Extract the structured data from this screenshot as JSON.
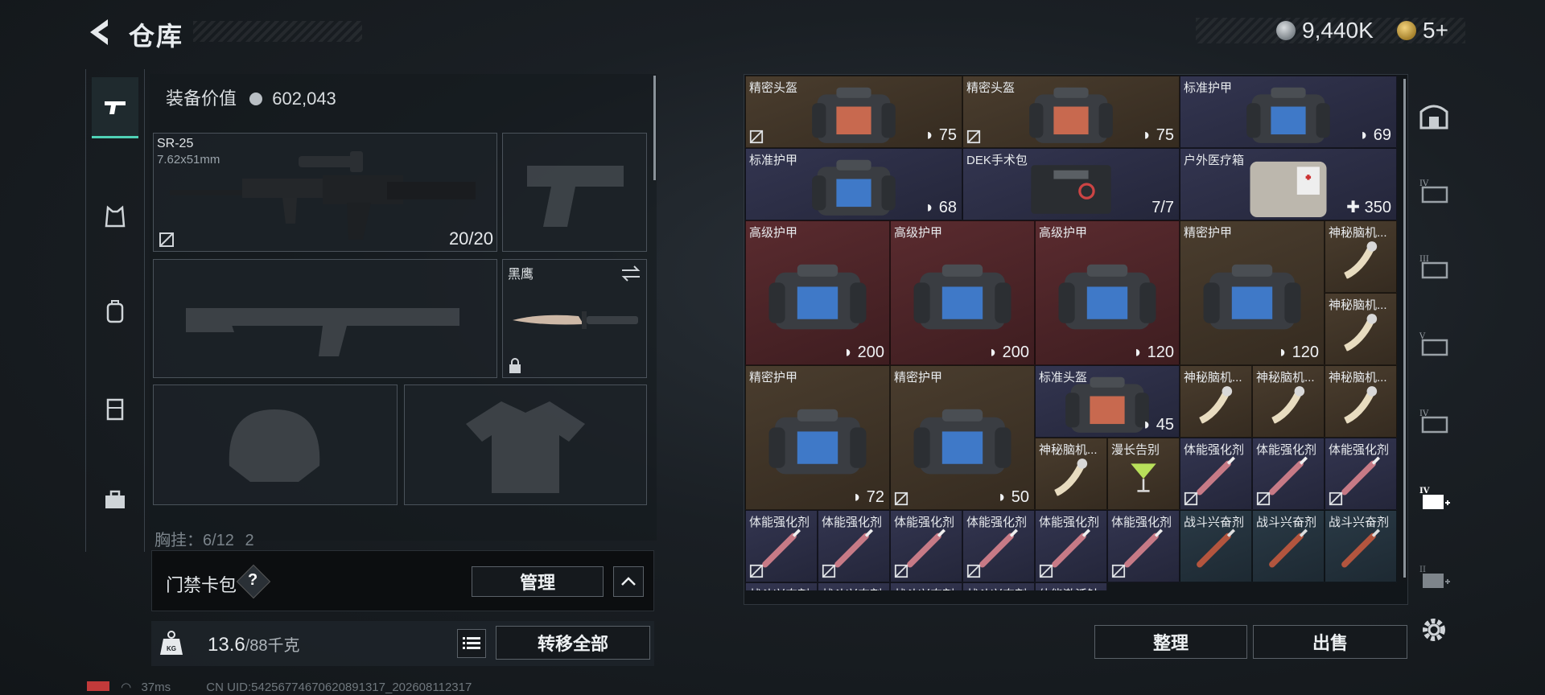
{
  "header": {
    "title": "仓库"
  },
  "currency": {
    "coins": "9,440K",
    "tickets": "5+",
    "colors": {
      "coin": "#b9bfc4",
      "ticket": "#d4aa45"
    }
  },
  "left_rail": {
    "items": [
      "pistol-icon",
      "vest-icon",
      "backpack-icon",
      "rig-icon",
      "toolbox-icon"
    ]
  },
  "equipment": {
    "value_label": "装备价值",
    "value": "602,043",
    "primary": {
      "name": "SR-25",
      "caliber": "7.62x51mm",
      "ammo": "20/20"
    },
    "melee": {
      "name": "黑鹰"
    },
    "chest_label": "胸挂：6/12",
    "chest_extra": "2"
  },
  "access_card": {
    "label": "门禁卡包",
    "help": "?",
    "manage": "管理"
  },
  "weight": {
    "value": "13.6",
    "max": "/88千克",
    "transfer_all": "转移全部"
  },
  "inventory": {
    "cells": [
      {
        "name": "精密头盔",
        "value": "75",
        "shield": true,
        "noicon": true,
        "bg": "brown",
        "item": "helmet"
      },
      {
        "name": "精密头盔",
        "value": "75",
        "shield": true,
        "noicon": true,
        "bg": "brown",
        "item": "helmet"
      },
      {
        "name": "标准护甲",
        "value": "69",
        "shield": true,
        "noicon": false,
        "bg": "purple",
        "item": "armor"
      },
      {
        "name": "标准护甲",
        "value": "68",
        "shield": true,
        "noicon": false,
        "bg": "purple",
        "item": "armor"
      },
      {
        "name": "DEK手术包",
        "value": "7/7",
        "shield": false,
        "noicon": false,
        "bg": "purple",
        "item": "surgery"
      },
      {
        "name": "户外医疗箱",
        "value": "350",
        "shield": false,
        "plus": true,
        "noicon": false,
        "bg": "purple",
        "item": "medbox"
      },
      {
        "name": "高级护甲",
        "value": "200",
        "shield": true,
        "noicon": false,
        "bg": "red",
        "item": "armor"
      },
      {
        "name": "高级护甲",
        "value": "200",
        "shield": true,
        "noicon": false,
        "bg": "red",
        "item": "armor"
      },
      {
        "name": "高级护甲",
        "value": "120",
        "shield": true,
        "noicon": false,
        "bg": "red",
        "item": "armor"
      },
      {
        "name": "精密护甲",
        "value": "120",
        "shield": true,
        "noicon": false,
        "bg": "brown",
        "item": "armor"
      },
      {
        "name": "神秘脑机...",
        "value": "",
        "shield": false,
        "noicon": false,
        "bg": "brown",
        "item": "scroll"
      },
      {
        "name": "神秘脑机...",
        "value": "",
        "shield": false,
        "noicon": false,
        "bg": "brown",
        "item": "scroll"
      },
      {
        "name": "精密护甲",
        "value": "72",
        "shield": true,
        "noicon": false,
        "bg": "brown",
        "item": "armor"
      },
      {
        "name": "精密护甲",
        "value": "50",
        "shield": true,
        "noicon": true,
        "bg": "brown",
        "item": "armor"
      },
      {
        "name": "标准头盔",
        "value": "45",
        "shield": true,
        "noicon": false,
        "bg": "purple",
        "item": "helmet"
      },
      {
        "name": "神秘脑机...",
        "value": "",
        "shield": false,
        "noicon": false,
        "bg": "brown",
        "item": "scroll"
      },
      {
        "name": "神秘脑机...",
        "value": "",
        "shield": false,
        "noicon": false,
        "bg": "brown",
        "item": "scroll"
      },
      {
        "name": "神秘脑机...",
        "value": "",
        "shield": false,
        "noicon": false,
        "bg": "brown",
        "item": "scroll"
      },
      {
        "name": "神秘脑机...",
        "value": "",
        "shield": false,
        "noicon": false,
        "bg": "brown",
        "item": "scroll"
      },
      {
        "name": "漫长告别",
        "value": "",
        "shield": false,
        "noicon": false,
        "bg": "brown",
        "item": "cocktail"
      },
      {
        "name": "体能强化剂",
        "value": "",
        "shield": false,
        "noicon": true,
        "bg": "purple",
        "item": "syringe"
      },
      {
        "name": "体能强化剂",
        "value": "",
        "shield": false,
        "noicon": true,
        "bg": "purple",
        "item": "syringe"
      },
      {
        "name": "体能强化剂",
        "value": "",
        "shield": false,
        "noicon": true,
        "bg": "purple",
        "item": "syringe"
      },
      {
        "name": "体能强化剂",
        "value": "",
        "shield": false,
        "noicon": true,
        "bg": "purple",
        "item": "syringe"
      },
      {
        "name": "体能强化剂",
        "value": "",
        "shield": false,
        "noicon": true,
        "bg": "purple",
        "item": "syringe"
      },
      {
        "name": "体能强化剂",
        "value": "",
        "shield": false,
        "noicon": true,
        "bg": "purple",
        "item": "syringe"
      },
      {
        "name": "体能强化剂",
        "value": "",
        "shield": false,
        "noicon": true,
        "bg": "purple",
        "item": "syringe"
      },
      {
        "name": "体能强化剂",
        "value": "",
        "shield": false,
        "noicon": true,
        "bg": "purple",
        "item": "syringe"
      },
      {
        "name": "体能强化剂",
        "value": "",
        "shield": false,
        "noicon": true,
        "bg": "purple",
        "item": "syringe"
      },
      {
        "name": "战斗兴奋剂",
        "value": "",
        "shield": false,
        "noicon": false,
        "bg": "blue",
        "item": "stim"
      },
      {
        "name": "战斗兴奋剂",
        "value": "",
        "shield": false,
        "noicon": false,
        "bg": "blue",
        "item": "stim"
      },
      {
        "name": "战斗兴奋剂",
        "value": "",
        "shield": false,
        "noicon": false,
        "bg": "blue",
        "item": "stim"
      },
      {
        "name": "战斗兴奋剂",
        "value": "",
        "shield": false,
        "noicon": false,
        "bg": "purple",
        "item": "stim"
      },
      {
        "name": "战斗兴奋剂",
        "value": "",
        "shield": false,
        "noicon": false,
        "bg": "purple",
        "item": "stim"
      },
      {
        "name": "战斗兴奋剂",
        "value": "",
        "shield": false,
        "noicon": false,
        "bg": "purple",
        "item": "stim"
      },
      {
        "name": "战斗兴奋剂",
        "value": "",
        "shield": false,
        "noicon": false,
        "bg": "purple",
        "item": "stim"
      },
      {
        "name": "体能激活针",
        "value": "",
        "shield": false,
        "noicon": false,
        "bg": "purple",
        "item": "stim"
      }
    ]
  },
  "bottom_buttons": {
    "sort": "整理",
    "sell": "出售"
  },
  "right_rail": {
    "items": [
      "safe-box-icon",
      "container-iv-icon",
      "container-iii-icon",
      "container-v-icon",
      "container-iv-b-icon",
      "medical-iv-icon",
      "medical-ii-icon",
      "settings-icon"
    ]
  },
  "status": {
    "ping": "37ms",
    "uid": "CN UID:54256774670620891317_202608112317"
  }
}
